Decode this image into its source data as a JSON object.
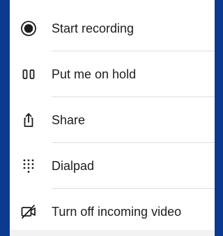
{
  "menu": {
    "items": [
      {
        "label": "Start recording",
        "icon": "record-icon"
      },
      {
        "label": "Put me on hold",
        "icon": "pause-icon"
      },
      {
        "label": "Share",
        "icon": "share-icon"
      },
      {
        "label": "Dialpad",
        "icon": "dialpad-icon"
      },
      {
        "label": "Turn off incoming video",
        "icon": "video-off-icon"
      }
    ]
  },
  "colors": {
    "frame": "#0b3a8f",
    "sheet": "#ffffff",
    "text": "#1c1c1c",
    "divider": "#dedede"
  }
}
